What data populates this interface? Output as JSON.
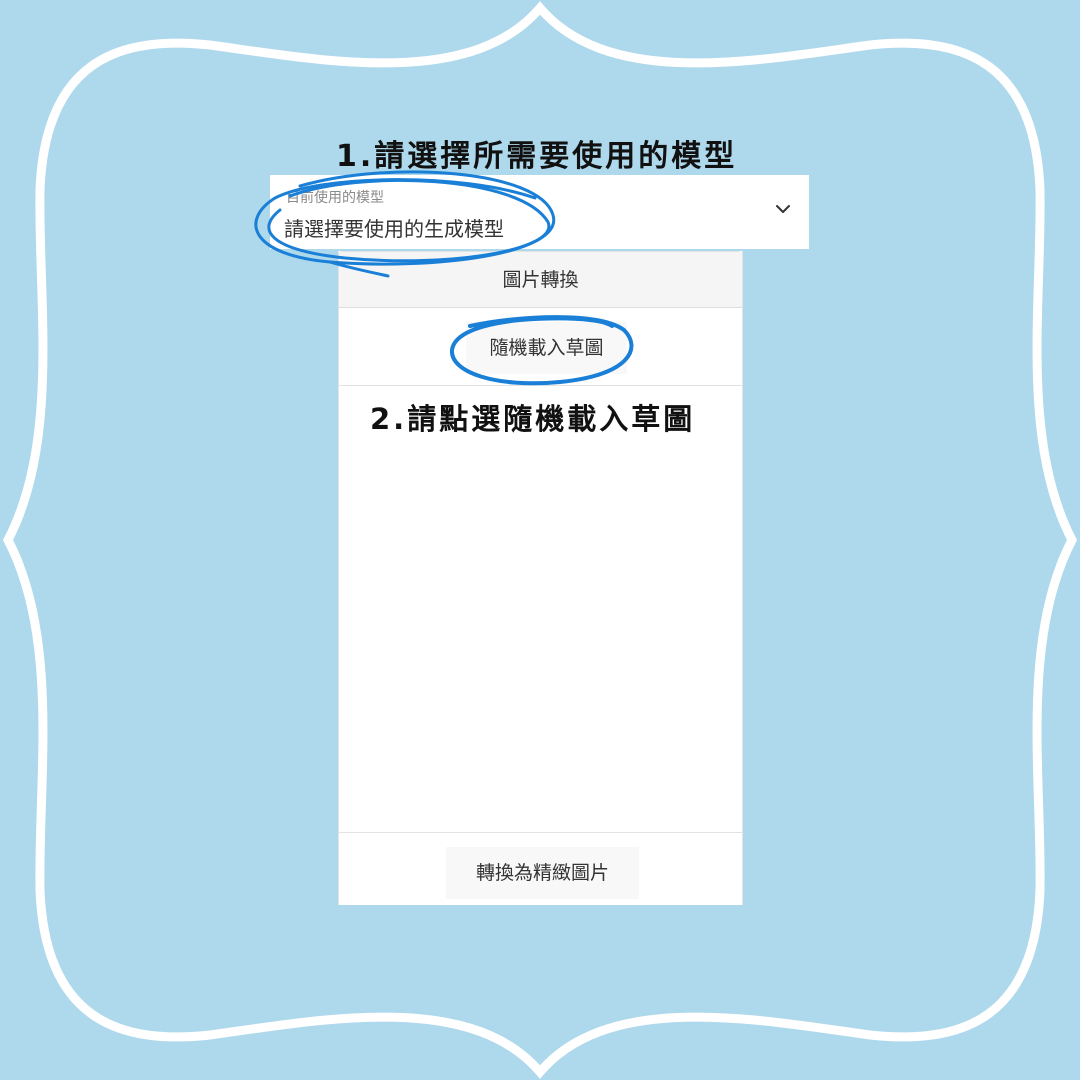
{
  "instructions": {
    "step1": "1.請選擇所需要使用的模型",
    "step2": "2.請點選隨機載入草圖"
  },
  "model_select": {
    "label": "目前使用的模型",
    "value": "請選擇要使用的生成模型",
    "icon": "chevron-down-icon"
  },
  "card": {
    "header": "圖片轉換",
    "random_load_label": "隨機載入草圖",
    "convert_label": "轉換為精緻圖片"
  },
  "colors": {
    "background": "#aed8ec",
    "frame": "#ffffff",
    "annotation": "#1a7fd6",
    "card_header": "#f5f5f5",
    "button_bg": "#f8f8f8"
  }
}
